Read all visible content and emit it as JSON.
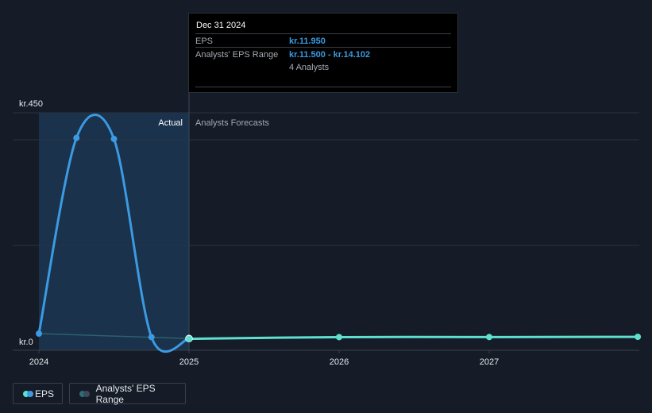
{
  "chart_data": {
    "type": "line",
    "title": "",
    "y_axis": {
      "top_label": "kr.450",
      "bottom_label": "kr.0",
      "ylim": [
        0,
        450
      ]
    },
    "x_axis": {
      "ticks": [
        "2024",
        "2025",
        "2026",
        "2027"
      ]
    },
    "regions": {
      "actual_label": "Actual",
      "forecast_label": "Analysts Forecasts"
    },
    "series": [
      {
        "name": "EPS",
        "kind": "actual",
        "color": "#3b9ae1",
        "x": [
          2024.0,
          2024.25,
          2024.5,
          2024.75,
          2025.0
        ],
        "values": [
          11.0,
          400.0,
          398.0,
          4.0,
          1.2
        ]
      },
      {
        "name": "EPS",
        "kind": "forecast",
        "color": "#5fe0cf",
        "x": [
          2025.0,
          2026.0,
          2027.0,
          2027.99
        ],
        "values": [
          0.6,
          4.0,
          4.2,
          4.6
        ]
      },
      {
        "name": "Analysts' EPS Range",
        "kind": "range",
        "color": "#2f6b7a",
        "x": [
          2024.0,
          2025.0
        ],
        "values": [
          11.0,
          1.2
        ]
      }
    ]
  },
  "tooltip": {
    "date": "Dec 31 2024",
    "rows": [
      {
        "key": "EPS",
        "value": "kr.11.950"
      },
      {
        "key": "Analysts' EPS Range",
        "value": "kr.11.500 - kr.14.102"
      },
      {
        "key": "",
        "value": "4 Analysts"
      }
    ]
  },
  "legend": {
    "eps_label": "EPS",
    "range_label": "Analysts' EPS Range",
    "eps_colors": [
      "#5fe0cf",
      "#3b9ae1"
    ],
    "range_colors": [
      "#2f6b7a",
      "#3d4a5a"
    ]
  }
}
